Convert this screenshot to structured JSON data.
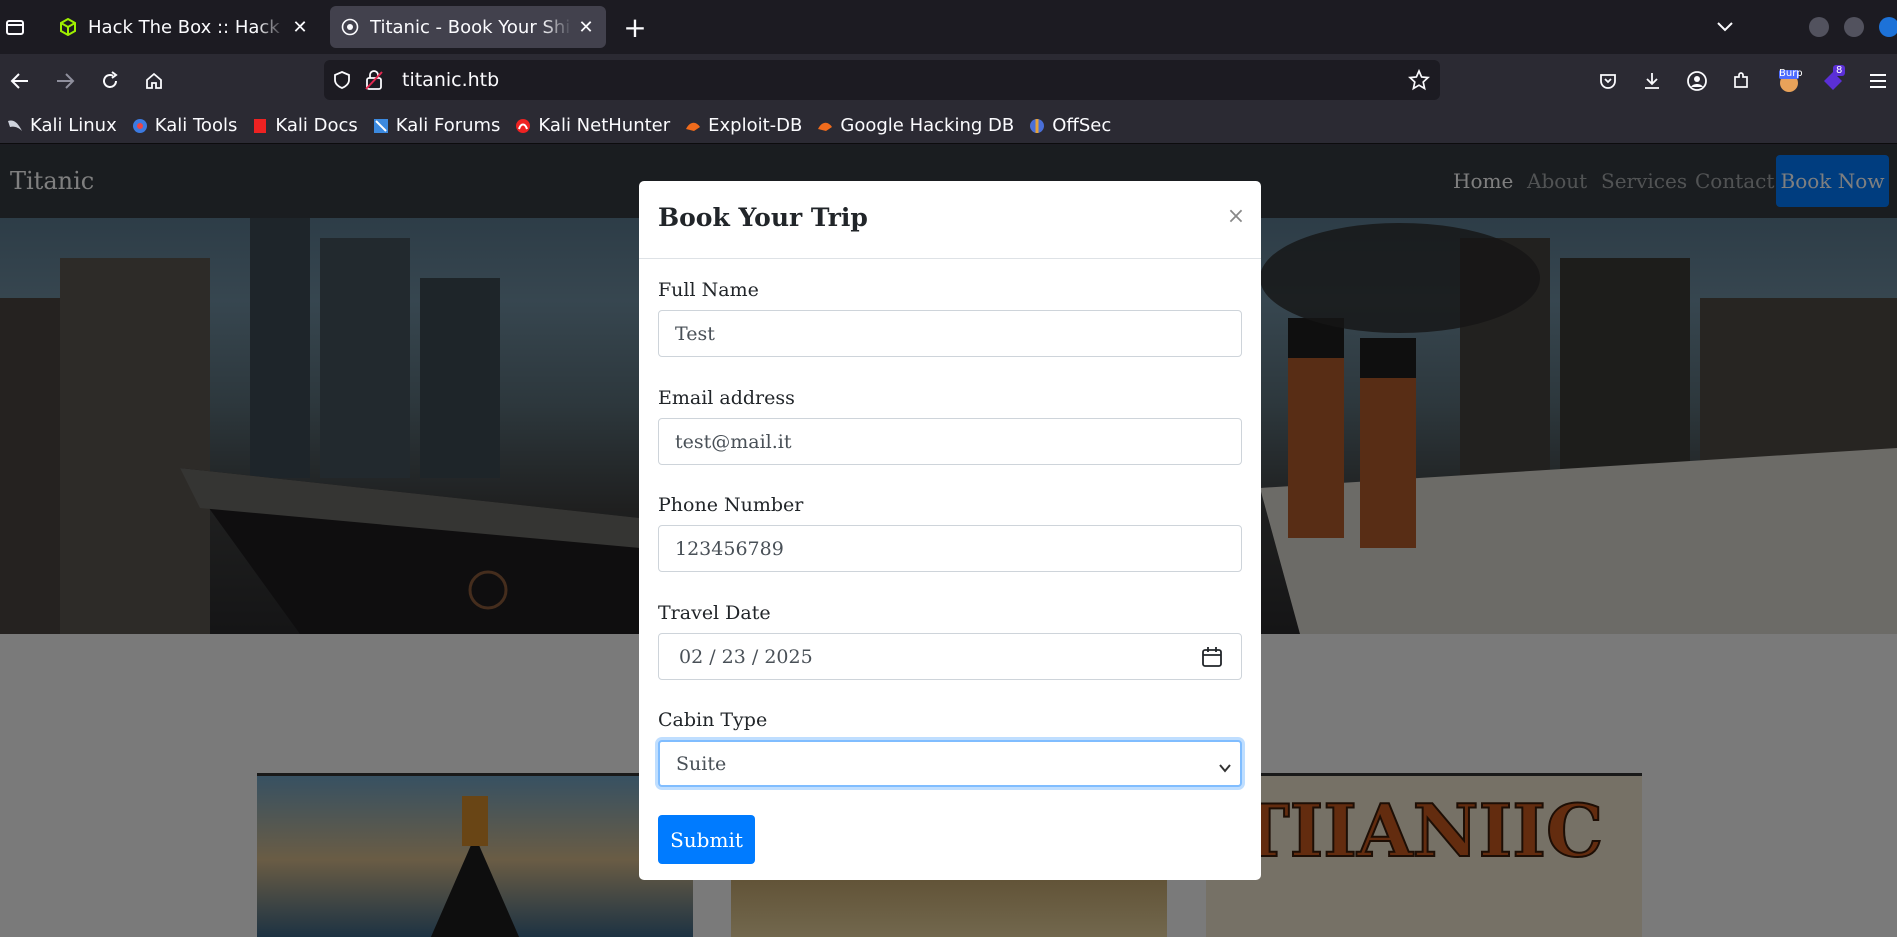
{
  "browser": {
    "tabs": [
      {
        "title": "Hack The Box :: Hack The Box",
        "favicon": "htb-cube-icon",
        "active": false
      },
      {
        "title": "Titanic - Book Your Ship Trip",
        "favicon": "titanic-site-icon",
        "active": true
      }
    ],
    "url": "titanic.htb",
    "bookmarks": [
      {
        "label": "Kali Linux",
        "icon": "kali-dragon-icon"
      },
      {
        "label": "Kali Tools",
        "icon": "kali-tools-icon"
      },
      {
        "label": "Kali Docs",
        "icon": "kali-docs-icon"
      },
      {
        "label": "Kali Forums",
        "icon": "kali-forums-icon"
      },
      {
        "label": "Kali NetHunter",
        "icon": "nethunter-icon"
      },
      {
        "label": "Exploit-DB",
        "icon": "exploit-db-icon"
      },
      {
        "label": "Google Hacking DB",
        "icon": "ghdb-icon"
      },
      {
        "label": "OffSec",
        "icon": "offsec-icon"
      }
    ],
    "extensions": {
      "burp_label": "Burp",
      "badge_count": "8"
    }
  },
  "site": {
    "brand": "Titanic",
    "nav": [
      "Home",
      "About",
      "Services",
      "Contact"
    ],
    "book_now": "Book Now"
  },
  "modal": {
    "title": "Book Your Trip",
    "close_symbol": "×",
    "fields": {
      "full_name": {
        "label": "Full Name",
        "value": "Test"
      },
      "email": {
        "label": "Email address",
        "value": "test@mail.it"
      },
      "phone": {
        "label": "Phone Number",
        "value": "123456789"
      },
      "travel_date": {
        "label": "Travel Date",
        "value": "02 / 23 / 2025"
      },
      "cabin_type": {
        "label": "Cabin Type",
        "value": "Suite"
      }
    },
    "submit_label": "Submit"
  },
  "colors": {
    "accent": "#007bff",
    "site_nav_bg": "#343a40",
    "browser_bg": "#1c1b22"
  }
}
